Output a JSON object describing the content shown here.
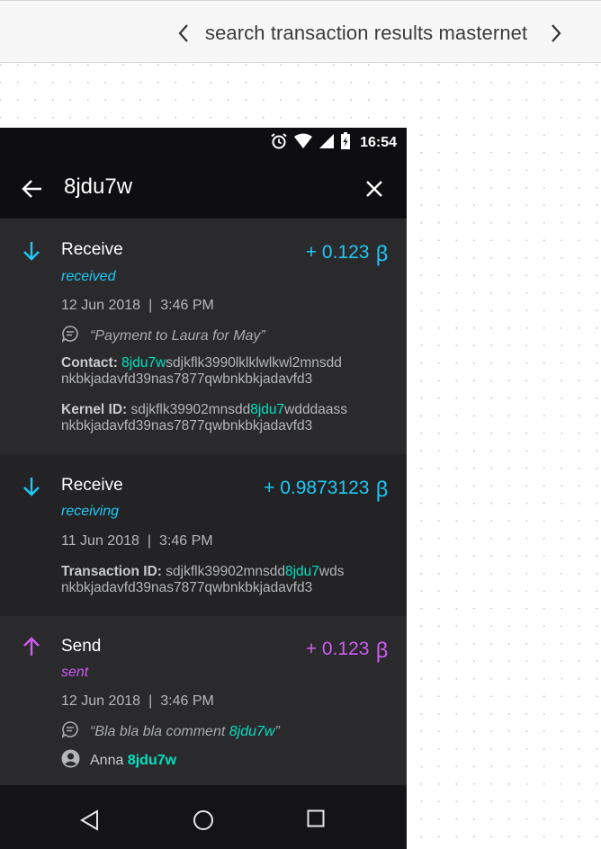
{
  "header": {
    "title": "search transaction results masternet"
  },
  "status_bar": {
    "time": "16:54",
    "icons": [
      "alarm-icon",
      "wifi-icon",
      "signal-icon",
      "battery-icon"
    ]
  },
  "search": {
    "query": "8jdu7w"
  },
  "transactions": [
    {
      "type": "Receive",
      "status": "received",
      "amount": "+ 0.123",
      "currency_symbol": "ꞵ",
      "date": "12 Jun 2018",
      "time": "3:46 PM",
      "comment": "“Payment to Laura for May”",
      "contact_label": "Contact:",
      "contact_match": "8jdu7w",
      "contact_rest_1": "sdjkflk3990lklklwlkwl2mnsdd",
      "contact_line_2": "nkbkjadavfd39nas7877qwbnkbkjadavfd3",
      "kernel_label": "Kernel ID:",
      "kernel_pre": "sdjkflk39902mnsdd",
      "kernel_match": "8jdu7",
      "kernel_post": "wdddaass",
      "kernel_line_2": "nkbkjadavfd39nas7877qwbnkbkjadavfd3",
      "accent_color": "#1ec8f4"
    },
    {
      "type": "Receive",
      "status": "receiving",
      "amount": "+ 0.9873123",
      "currency_symbol": "ꞵ",
      "date": "11 Jun 2018",
      "time": "3:46 PM",
      "txid_label": "Transaction ID:",
      "txid_pre": "sdjkflk39902mnsdd",
      "txid_match": "8jdu7",
      "txid_post": "wds",
      "txid_line_2": "nkbkjadavfd39nas7877qwbnkbkjadavfd3",
      "accent_color": "#1ec8f4"
    },
    {
      "type": "Send",
      "status": "sent",
      "amount": "+ 0.123",
      "currency_symbol": "ꞵ",
      "date": "12 Jun 2018",
      "time": "3:46 PM",
      "comment_pre": "“Bla bla bla comment ",
      "comment_match": "8jdu7w",
      "comment_post": "”",
      "contact_name": "Anna",
      "contact_match": "8jdu7w",
      "accent_color": "#d05bf5"
    }
  ],
  "date_separator": "|",
  "highlight_color": "#00e2c2"
}
